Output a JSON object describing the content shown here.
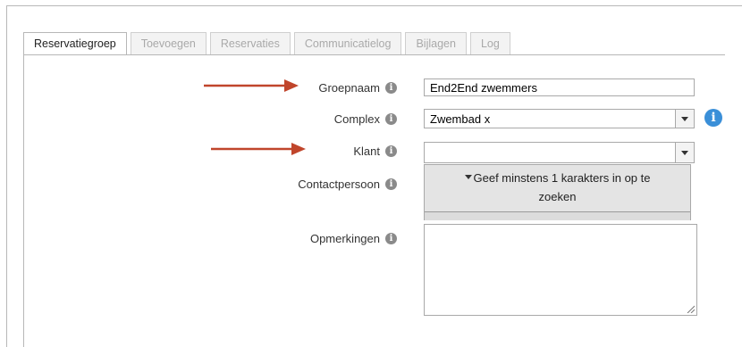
{
  "tabs": [
    {
      "label": "Reservatiegroep",
      "active": true
    },
    {
      "label": "Toevoegen",
      "active": false
    },
    {
      "label": "Reservaties",
      "active": false
    },
    {
      "label": "Communicatielog",
      "active": false
    },
    {
      "label": "Bijlagen",
      "active": false
    },
    {
      "label": "Log",
      "active": false
    }
  ],
  "form": {
    "groepnaam": {
      "label": "Groepnaam",
      "value": "End2End zwemmers"
    },
    "complex": {
      "label": "Complex",
      "value": "Zwembad x"
    },
    "klant": {
      "label": "Klant",
      "value": ""
    },
    "contactpersoon": {
      "label": "Contactpersoon",
      "hint_line1": "Geef minstens 1 karakters in op te",
      "hint_line2": "zoeken"
    },
    "opmerkingen": {
      "label": "Opmerkingen",
      "value": ""
    }
  },
  "icons": {
    "info_small": "info-icon",
    "info_large": "info-circle-icon",
    "annotation_arrow": "red-arrow-icon"
  },
  "colors": {
    "arrow": "#c0452b",
    "info_blue": "#3a8fd8",
    "info_gray": "#8a8a8a"
  }
}
